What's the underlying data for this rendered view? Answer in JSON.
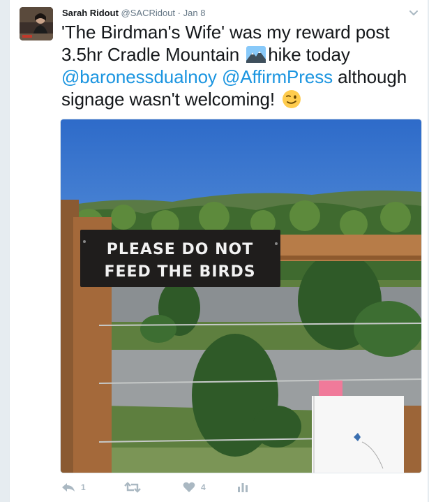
{
  "tweet": {
    "display_name": "Sarah Ridout",
    "handle": "@SACRidout",
    "separator": "·",
    "date": "Jan 8",
    "text_part1": "'The Birdman's Wife' was my reward post 3.5hr Cradle Mountain ",
    "text_part2": "hike today ",
    "mention1": "@baronessdualnoy",
    "mention2": "@AffirmPress",
    "text_part3": " although signage wasn't welcoming! ",
    "sign_line1": "PLEASE DO NOT",
    "sign_line2": "FEED THE BIRDS"
  },
  "actions": {
    "reply_count": "1",
    "retweet_count": "",
    "like_count": "4"
  },
  "colors": {
    "link": "#1b95e0",
    "text": "#14171a",
    "muted": "#657786",
    "action": "#aab8c2"
  },
  "icons": [
    "chevron-down-icon",
    "mountain-emoji-icon",
    "wink-emoji-icon",
    "reply-icon",
    "retweet-icon",
    "like-icon",
    "analytics-icon"
  ]
}
